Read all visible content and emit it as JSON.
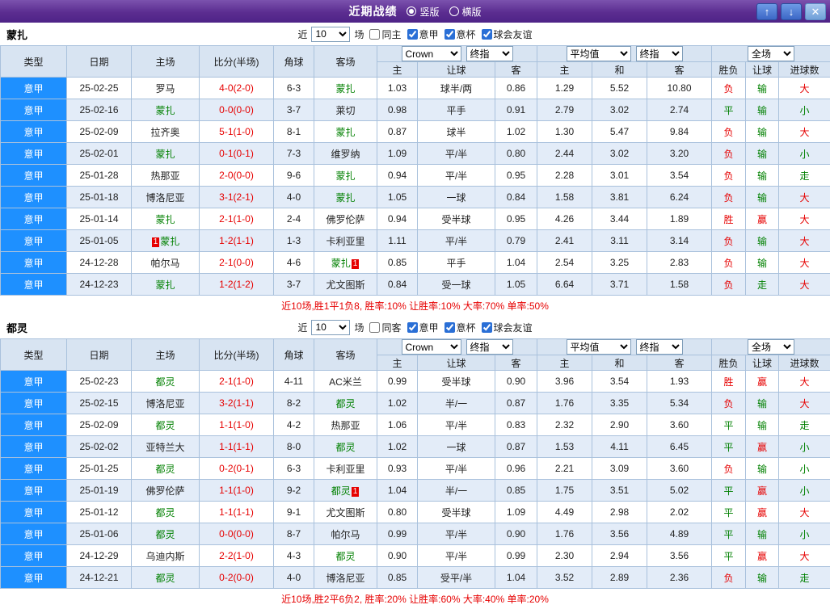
{
  "titlebar": {
    "title": "近期战绩",
    "vertical_label": "竖版",
    "vertical_selected": true,
    "horizontal_label": "横版",
    "horizontal_selected": false,
    "up_glyph": "↑",
    "down_glyph": "↓",
    "close_glyph": "✕"
  },
  "colors": {
    "accent_purple": "#5b2d90",
    "header_bg": "#d8e4f2",
    "row_alt_bg": "#e3ecf8",
    "league_cell_bg": "#1e90ff",
    "focus_team_green": "#008000",
    "score_red": "#e60000",
    "button_blue": "#3c67c6"
  },
  "result_colors": {
    "胜": "#e60000",
    "负": "#e60000",
    "平": "#008000",
    "赢": "#e60000",
    "输": "#008000",
    "走": "#008000",
    "大": "#e60000",
    "小": "#008000"
  },
  "filters": {
    "near_label": "近",
    "count": "10",
    "matches_label": "场",
    "leagues": [
      "意甲",
      "意杯",
      "球会友谊"
    ],
    "league_checked": [
      true,
      true,
      true
    ]
  },
  "table_header": {
    "main": [
      "类型",
      "日期",
      "主场",
      "比分(半场)",
      "角球",
      "客场"
    ],
    "sub": [
      "主",
      "让球",
      "客",
      "主",
      "和",
      "客",
      "胜负",
      "让球",
      "进球数"
    ],
    "bookmaker": "Crown",
    "final_label": "终指",
    "average_label": "平均值",
    "fullmatch_label": "全场"
  },
  "sections": [
    {
      "team": "蒙扎",
      "filter": {
        "same_label": "同主",
        "same_checked": false
      },
      "rows": [
        {
          "league": "意甲",
          "date": "25-02-25",
          "home": "罗马",
          "home_focus": false,
          "score": "4-0(2-0)",
          "corner": "6-3",
          "away": "蒙扎",
          "away_focus": true,
          "h_odds": "1.03",
          "handicap": "球半/两",
          "a_odds": "0.86",
          "eu_h": "1.29",
          "eu_d": "5.52",
          "eu_a": "10.80",
          "wdl": "负",
          "hcp_res": "输",
          "goal_res": "大"
        },
        {
          "league": "意甲",
          "date": "25-02-16",
          "home": "蒙扎",
          "home_focus": true,
          "score": "0-0(0-0)",
          "corner": "3-7",
          "away": "莱切",
          "away_focus": false,
          "h_odds": "0.98",
          "handicap": "平手",
          "a_odds": "0.91",
          "eu_h": "2.79",
          "eu_d": "3.02",
          "eu_a": "2.74",
          "wdl": "平",
          "hcp_res": "输",
          "goal_res": "小"
        },
        {
          "league": "意甲",
          "date": "25-02-09",
          "home": "拉齐奥",
          "home_focus": false,
          "score": "5-1(1-0)",
          "corner": "8-1",
          "away": "蒙扎",
          "away_focus": true,
          "h_odds": "0.87",
          "handicap": "球半",
          "a_odds": "1.02",
          "eu_h": "1.30",
          "eu_d": "5.47",
          "eu_a": "9.84",
          "wdl": "负",
          "hcp_res": "输",
          "goal_res": "大"
        },
        {
          "league": "意甲",
          "date": "25-02-01",
          "home": "蒙扎",
          "home_focus": true,
          "score": "0-1(0-1)",
          "corner": "7-3",
          "away": "维罗纳",
          "away_focus": false,
          "h_odds": "1.09",
          "handicap": "平/半",
          "a_odds": "0.80",
          "eu_h": "2.44",
          "eu_d": "3.02",
          "eu_a": "3.20",
          "wdl": "负",
          "hcp_res": "输",
          "goal_res": "小"
        },
        {
          "league": "意甲",
          "date": "25-01-28",
          "home": "热那亚",
          "home_focus": false,
          "score": "2-0(0-0)",
          "corner": "9-6",
          "away": "蒙扎",
          "away_focus": true,
          "h_odds": "0.94",
          "handicap": "平/半",
          "a_odds": "0.95",
          "eu_h": "2.28",
          "eu_d": "3.01",
          "eu_a": "3.54",
          "wdl": "负",
          "hcp_res": "输",
          "goal_res": "走"
        },
        {
          "league": "意甲",
          "date": "25-01-18",
          "home": "博洛尼亚",
          "home_focus": false,
          "score": "3-1(2-1)",
          "corner": "4-0",
          "away": "蒙扎",
          "away_focus": true,
          "h_odds": "1.05",
          "handicap": "一球",
          "a_odds": "0.84",
          "eu_h": "1.58",
          "eu_d": "3.81",
          "eu_a": "6.24",
          "wdl": "负",
          "hcp_res": "输",
          "goal_res": "大"
        },
        {
          "league": "意甲",
          "date": "25-01-14",
          "home": "蒙扎",
          "home_focus": true,
          "score": "2-1(1-0)",
          "corner": "2-4",
          "away": "佛罗伦萨",
          "away_focus": false,
          "h_odds": "0.94",
          "handicap": "受半球",
          "a_odds": "0.95",
          "eu_h": "4.26",
          "eu_d": "3.44",
          "eu_a": "1.89",
          "wdl": "胜",
          "hcp_res": "赢",
          "goal_res": "大"
        },
        {
          "league": "意甲",
          "date": "25-01-05",
          "home": "蒙扎",
          "home_focus": true,
          "home_badge": "1",
          "home_badge_pos": "before",
          "score": "1-2(1-1)",
          "corner": "1-3",
          "away": "卡利亚里",
          "away_focus": false,
          "h_odds": "1.11",
          "handicap": "平/半",
          "a_odds": "0.79",
          "eu_h": "2.41",
          "eu_d": "3.11",
          "eu_a": "3.14",
          "wdl": "负",
          "hcp_res": "输",
          "goal_res": "大"
        },
        {
          "league": "意甲",
          "date": "24-12-28",
          "home": "帕尔马",
          "home_focus": false,
          "score": "2-1(0-0)",
          "corner": "4-6",
          "away": "蒙扎",
          "away_focus": true,
          "away_badge": "1",
          "away_badge_pos": "after",
          "h_odds": "0.85",
          "handicap": "平手",
          "a_odds": "1.04",
          "eu_h": "2.54",
          "eu_d": "3.25",
          "eu_a": "2.83",
          "wdl": "负",
          "hcp_res": "输",
          "goal_res": "大"
        },
        {
          "league": "意甲",
          "date": "24-12-23",
          "home": "蒙扎",
          "home_focus": true,
          "score": "1-2(1-2)",
          "corner": "3-7",
          "away": "尤文图斯",
          "away_focus": false,
          "h_odds": "0.84",
          "handicap": "受一球",
          "a_odds": "1.05",
          "eu_h": "6.64",
          "eu_d": "3.71",
          "eu_a": "1.58",
          "wdl": "负",
          "hcp_res": "走",
          "goal_res": "大"
        }
      ],
      "summary": "近10场,胜1平1负8, 胜率:10% 让胜率:10% 大率:70% 单率:50%"
    },
    {
      "team": "都灵",
      "filter": {
        "same_label": "同客",
        "same_checked": false
      },
      "rows": [
        {
          "league": "意甲",
          "date": "25-02-23",
          "home": "都灵",
          "home_focus": true,
          "score": "2-1(1-0)",
          "corner": "4-11",
          "away": "AC米兰",
          "away_focus": false,
          "h_odds": "0.99",
          "handicap": "受半球",
          "a_odds": "0.90",
          "eu_h": "3.96",
          "eu_d": "3.54",
          "eu_a": "1.93",
          "wdl": "胜",
          "hcp_res": "赢",
          "goal_res": "大"
        },
        {
          "league": "意甲",
          "date": "25-02-15",
          "home": "博洛尼亚",
          "home_focus": false,
          "score": "3-2(1-1)",
          "corner": "8-2",
          "away": "都灵",
          "away_focus": true,
          "h_odds": "1.02",
          "handicap": "半/一",
          "a_odds": "0.87",
          "eu_h": "1.76",
          "eu_d": "3.35",
          "eu_a": "5.34",
          "wdl": "负",
          "hcp_res": "输",
          "goal_res": "大"
        },
        {
          "league": "意甲",
          "date": "25-02-09",
          "home": "都灵",
          "home_focus": true,
          "score": "1-1(1-0)",
          "corner": "4-2",
          "away": "热那亚",
          "away_focus": false,
          "h_odds": "1.06",
          "handicap": "平/半",
          "a_odds": "0.83",
          "eu_h": "2.32",
          "eu_d": "2.90",
          "eu_a": "3.60",
          "wdl": "平",
          "hcp_res": "输",
          "goal_res": "走"
        },
        {
          "league": "意甲",
          "date": "25-02-02",
          "home": "亚特兰大",
          "home_focus": false,
          "score": "1-1(1-1)",
          "corner": "8-0",
          "away": "都灵",
          "away_focus": true,
          "h_odds": "1.02",
          "handicap": "一球",
          "a_odds": "0.87",
          "eu_h": "1.53",
          "eu_d": "4.11",
          "eu_a": "6.45",
          "wdl": "平",
          "hcp_res": "赢",
          "goal_res": "小"
        },
        {
          "league": "意甲",
          "date": "25-01-25",
          "home": "都灵",
          "home_focus": true,
          "score": "0-2(0-1)",
          "corner": "6-3",
          "away": "卡利亚里",
          "away_focus": false,
          "h_odds": "0.93",
          "handicap": "平/半",
          "a_odds": "0.96",
          "eu_h": "2.21",
          "eu_d": "3.09",
          "eu_a": "3.60",
          "wdl": "负",
          "hcp_res": "输",
          "goal_res": "小"
        },
        {
          "league": "意甲",
          "date": "25-01-19",
          "home": "佛罗伦萨",
          "home_focus": false,
          "score": "1-1(1-0)",
          "corner": "9-2",
          "away": "都灵",
          "away_focus": true,
          "away_badge": "1",
          "away_badge_pos": "after",
          "h_odds": "1.04",
          "handicap": "半/一",
          "a_odds": "0.85",
          "eu_h": "1.75",
          "eu_d": "3.51",
          "eu_a": "5.02",
          "wdl": "平",
          "hcp_res": "赢",
          "goal_res": "小"
        },
        {
          "league": "意甲",
          "date": "25-01-12",
          "home": "都灵",
          "home_focus": true,
          "score": "1-1(1-1)",
          "corner": "9-1",
          "away": "尤文图斯",
          "away_focus": false,
          "h_odds": "0.80",
          "handicap": "受半球",
          "a_odds": "1.09",
          "eu_h": "4.49",
          "eu_d": "2.98",
          "eu_a": "2.02",
          "wdl": "平",
          "hcp_res": "赢",
          "goal_res": "大"
        },
        {
          "league": "意甲",
          "date": "25-01-06",
          "home": "都灵",
          "home_focus": true,
          "score": "0-0(0-0)",
          "corner": "8-7",
          "away": "帕尔马",
          "away_focus": false,
          "h_odds": "0.99",
          "handicap": "平/半",
          "a_odds": "0.90",
          "eu_h": "1.76",
          "eu_d": "3.56",
          "eu_a": "4.89",
          "wdl": "平",
          "hcp_res": "输",
          "goal_res": "小"
        },
        {
          "league": "意甲",
          "date": "24-12-29",
          "home": "乌迪内斯",
          "home_focus": false,
          "score": "2-2(1-0)",
          "corner": "4-3",
          "away": "都灵",
          "away_focus": true,
          "h_odds": "0.90",
          "handicap": "平/半",
          "a_odds": "0.99",
          "eu_h": "2.30",
          "eu_d": "2.94",
          "eu_a": "3.56",
          "wdl": "平",
          "hcp_res": "赢",
          "goal_res": "大"
        },
        {
          "league": "意甲",
          "date": "24-12-21",
          "home": "都灵",
          "home_focus": true,
          "score": "0-2(0-0)",
          "corner": "4-0",
          "away": "博洛尼亚",
          "away_focus": false,
          "h_odds": "0.85",
          "handicap": "受平/半",
          "a_odds": "1.04",
          "eu_h": "3.52",
          "eu_d": "2.89",
          "eu_a": "2.36",
          "wdl": "负",
          "hcp_res": "输",
          "goal_res": "走"
        }
      ],
      "summary": "近10场,胜2平6负2, 胜率:20% 让胜率:60% 大率:40% 单率:20%"
    }
  ]
}
